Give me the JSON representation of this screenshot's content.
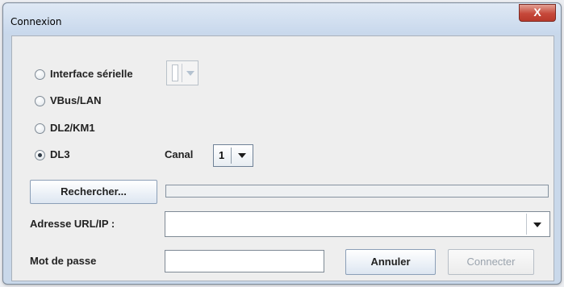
{
  "window": {
    "title": "Connexion",
    "close_label": "X"
  },
  "connection": {
    "serial_label": "Interface sérielle",
    "vbus_label": "VBus/LAN",
    "dl2_label": "DL2/KM1",
    "dl3_label": "DL3",
    "selected": "DL3"
  },
  "canal": {
    "label": "Canal",
    "value": "1"
  },
  "search": {
    "button_label": "Rechercher...",
    "progress": 0
  },
  "address": {
    "label": "Adresse URL/IP :",
    "value": ""
  },
  "password": {
    "label": "Mot de passe",
    "value": ""
  },
  "buttons": {
    "cancel_label": "Annuler",
    "connect_label": "Connecter"
  },
  "icons": {
    "dropdown": "chevron-down-icon",
    "close": "close-icon"
  }
}
